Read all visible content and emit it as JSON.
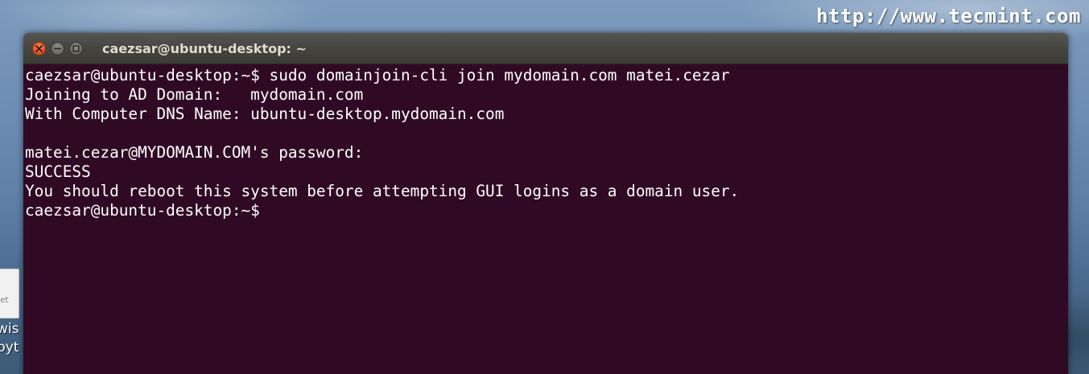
{
  "watermark": "http://www.tecmint.com",
  "desktop": {
    "file_icon_label": "get",
    "file_name_lines": [
      "wis",
      "byt"
    ]
  },
  "window": {
    "title": "caezsar@ubuntu-desktop: ~",
    "buttons": {
      "close_icon": "close-icon",
      "minimize_icon": "minimize-icon",
      "maximize_icon": "maximize-icon"
    }
  },
  "terminal": {
    "background": "#300a24",
    "foreground": "#ffffff",
    "lines": [
      "caezsar@ubuntu-desktop:~$ sudo domainjoin-cli join mydomain.com matei.cezar",
      "Joining to AD Domain:   mydomain.com",
      "With Computer DNS Name: ubuntu-desktop.mydomain.com",
      "",
      "matei.cezar@MYDOMAIN.COM's password:",
      "SUCCESS",
      "You should reboot this system before attempting GUI logins as a domain user.",
      "caezsar@ubuntu-desktop:~$ "
    ]
  }
}
